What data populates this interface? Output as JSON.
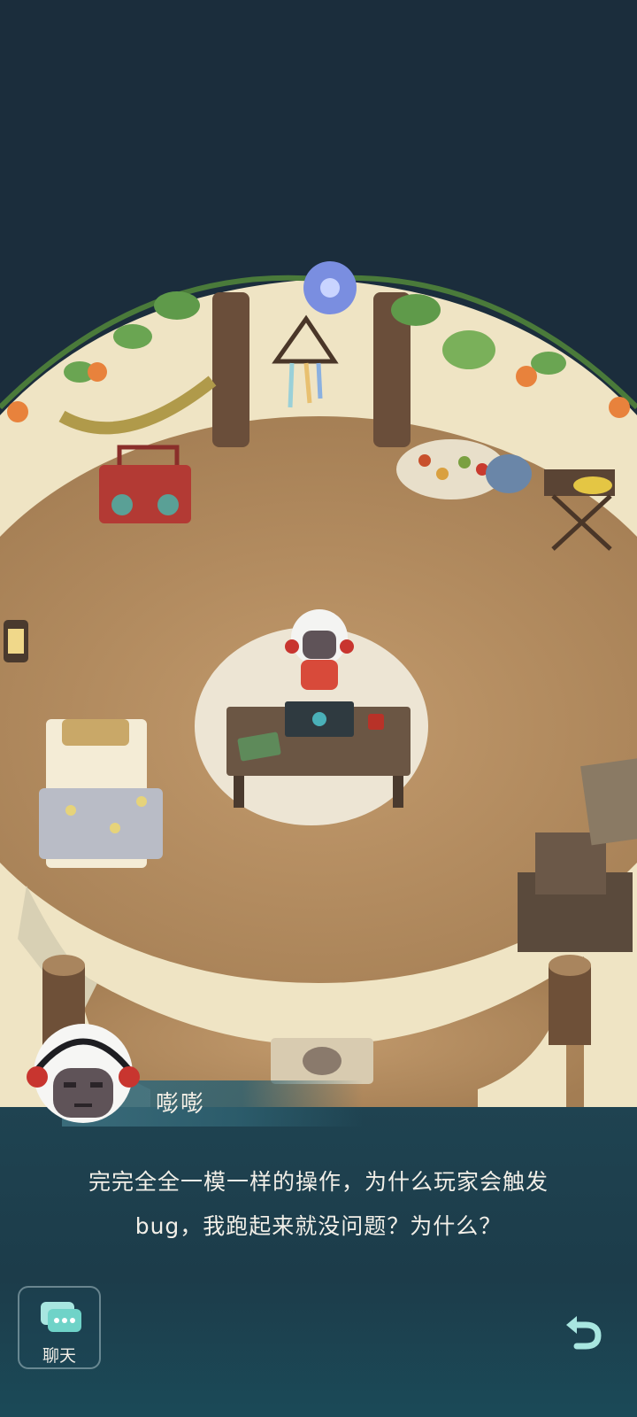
{
  "dialog": {
    "speaker": "嘭嘭",
    "line1": "完完全全一模一样的操作，为什么玩家会触发",
    "line2": "bug，我跑起来就没问题？为什么？"
  },
  "controls": {
    "chat_label": "聊天"
  },
  "icons": {
    "chat": "chat-bubble-icon",
    "back": "undo-arrow-icon"
  },
  "colors": {
    "background": "#1b2d3c",
    "floor": "#b08a60",
    "wall": "#f0e6c8",
    "panel": "#1f4351",
    "accent_red": "#c8352f"
  }
}
